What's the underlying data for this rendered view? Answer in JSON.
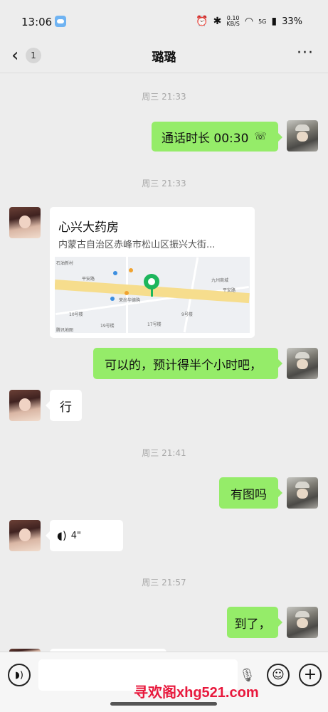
{
  "status_bar": {
    "time": "13:06",
    "net_speed_value": "0.10",
    "net_speed_unit": "KB/S",
    "network_type": "5G",
    "battery": "33%"
  },
  "header": {
    "unread_count": "1",
    "title": "璐璐"
  },
  "messages": {
    "ts1": "周三 21:33",
    "call_text": "通话时长 00:30",
    "ts2": "周三 21:33",
    "location_name": "心兴大药房",
    "location_address": "内蒙古自治区赤峰市松山区振兴大街...",
    "map": {
      "road1": "平安路",
      "road2": "平安路",
      "attribution": "腾讯地图",
      "label_a": "石油新村",
      "label_b": "九州商城",
      "label_c": "荣尚华德购",
      "label_d": "10号楼",
      "label_e": "9号楼",
      "label_f": "19号楼",
      "label_g": "17号楼"
    },
    "msg_reply1": "可以的，预计得半个小时吧，",
    "msg_ok": "行",
    "ts3": "周三 21:41",
    "msg_photo": "有图吗",
    "voice_duration": "4\"",
    "ts4": "周三 21:57",
    "msg_arrived": "到了，"
  },
  "input_bar": {
    "placeholder": "",
    "watermark": "寻欢阁xhg521.com"
  }
}
